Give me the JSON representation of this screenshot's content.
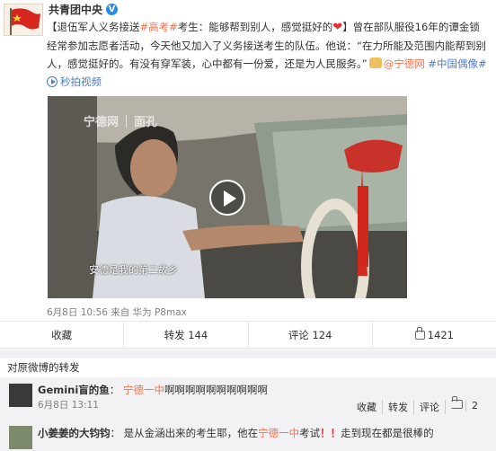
{
  "post": {
    "author": "共青团中央",
    "verified": "V",
    "text_1": "【退伍军人义务接送",
    "tag_gaokao": "#高考#",
    "text_2": "考生：能够帮到别人，感觉挺好的",
    "heart": "❤",
    "text_3": "】曾在部队服役16年的谭金锁经常参加志愿者活动，今天他又加入了义务接送考生的队伍。他说：“在力所能及范围内能帮到别人，感觉挺好的。有没有穿军装，心中都有一份爱，还是为人民服务。”",
    "link_ningde": "@宁德网",
    "tag_idol": "#中国偶像#",
    "video_link": "秒拍视频",
    "video": {
      "watermark_left": "宁德网",
      "watermark_right": "面孔",
      "subtitle": "安德是我的第二故乡"
    },
    "meta": "6月8日 10:56  来自 华为 P8max",
    "actions": {
      "collect": "收藏",
      "repost": "转发 144",
      "comment": "评论 124",
      "likes": "1421"
    }
  },
  "reposts": {
    "title": "对原微博的转发",
    "items": [
      {
        "name": "Gemini盲的鱼",
        "sep": "：",
        "mention": "宁德一中",
        "text": "啊啊啊啊啊啊啊啊啊啊",
        "time": "6月8日 13:11",
        "actions": {
          "collect": "收藏",
          "repost": "转发",
          "comment": "评论",
          "likes": "2"
        }
      },
      {
        "name": "小姜姜的大钧钧",
        "sep": "：",
        "text_a": "是从金涵出来的考生耶，他在",
        "mention": "宁德一中",
        "text_b": "考试",
        "excl": "！！",
        "text_c": "走到现在都是很棒的"
      }
    ]
  }
}
